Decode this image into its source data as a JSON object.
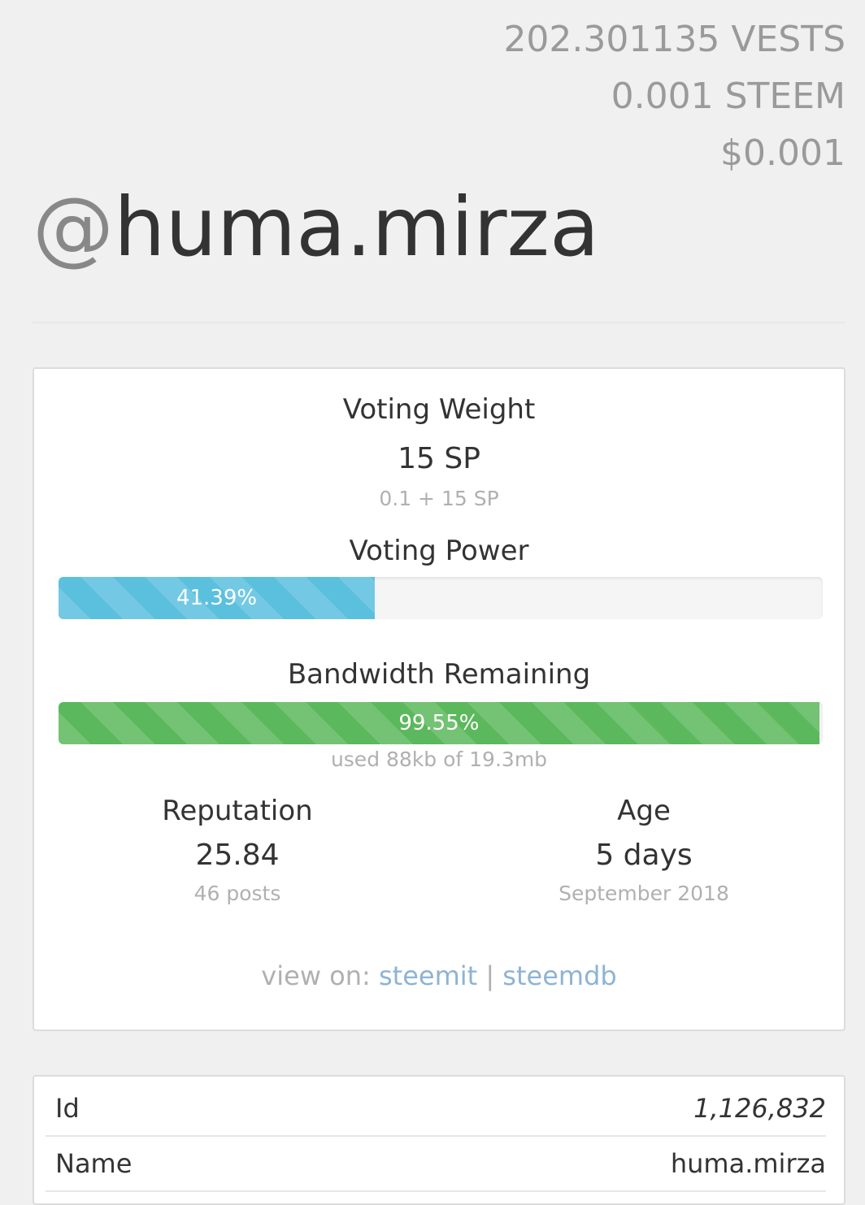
{
  "balances": {
    "vests": "202.301135 VESTS",
    "steem": "0.001 STEEM",
    "usd": "$0.001"
  },
  "account": {
    "at": "@",
    "name": "huma.mirza"
  },
  "stats": {
    "voting_weight": {
      "label": "Voting Weight",
      "value": "15 SP",
      "detail": "0.1 + 15 SP"
    },
    "voting_power": {
      "label": "Voting Power",
      "percent_text": "41.39%",
      "percent": 41.39,
      "color": "#5bc0de"
    },
    "bandwidth": {
      "label": "Bandwidth Remaining",
      "percent_text": "99.55%",
      "percent": 99.55,
      "detail": "used 88kb of 19.3mb",
      "color": "#5cb85c"
    },
    "reputation": {
      "label": "Reputation",
      "value": "25.84",
      "detail": "46 posts"
    },
    "age": {
      "label": "Age",
      "value": "5 days",
      "detail": "September 2018"
    },
    "view_on": {
      "prefix": "view on:",
      "link1": "steemit",
      "separator": "|",
      "link2": "steemdb"
    }
  },
  "properties": [
    {
      "key": "Id",
      "value": "1,126,832"
    },
    {
      "key": "Name",
      "value": "huma.mirza"
    }
  ]
}
